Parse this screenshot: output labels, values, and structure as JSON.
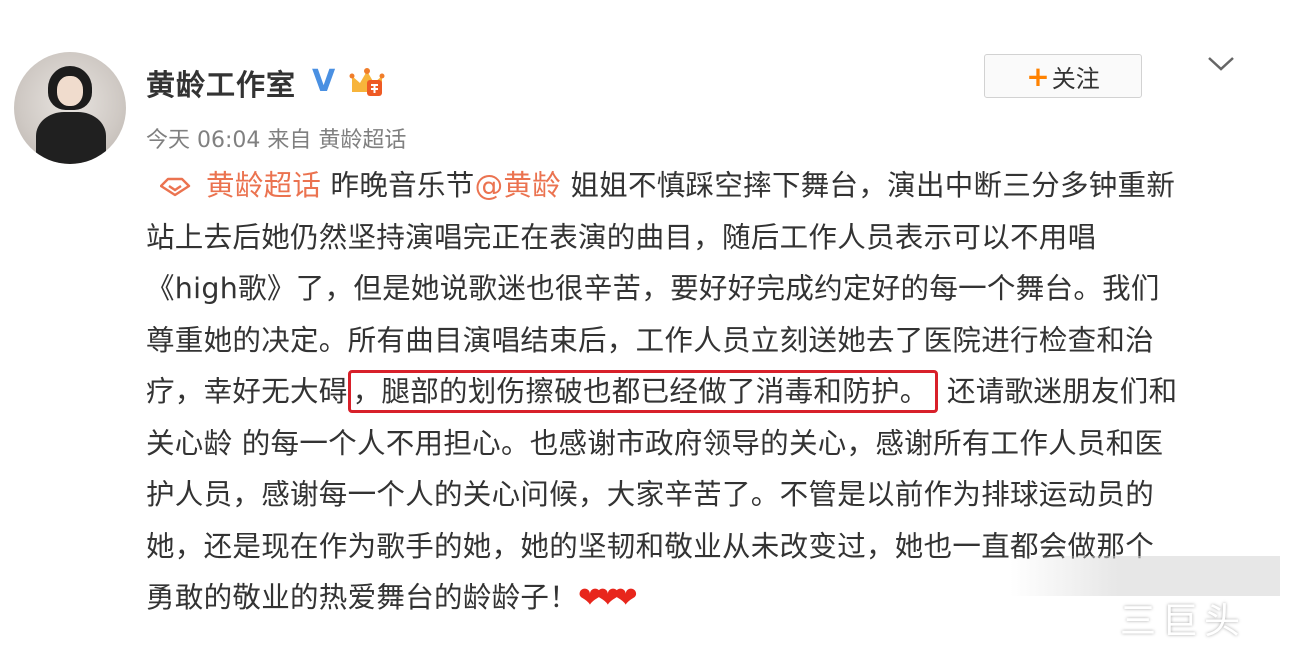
{
  "post": {
    "username": "黄龄工作室",
    "verified_mark": "V",
    "follow_label": "关注",
    "follow_plus": "+",
    "meta": "今天 06:04 来自 黄龄超话"
  },
  "content": {
    "line1_topic": "黄龄超话",
    "line1_a": " 昨晚音乐节",
    "line1_mention": "@黄龄",
    "line1_b": " 姐姐不慎踩空摔下舞台，演出中断三分多钟重新",
    "line2": "站上去后她仍然坚持演唱完正在表演的曲目，随后工作人员表示可以不用唱",
    "line3": "《high歌》了，但是她说歌迷也很辛苦，要好好完成约定好的每一个舞台。我们",
    "line4": "尊重她的决定。所有曲目演唱结束后，工作人员立刻送她去了医院进行检查和治",
    "line5_a": "疗，幸好无大碍",
    "line5_highlight": "，腿部的划伤擦破也都已经做了消毒和防护。",
    "line5_b": " 还请歌迷朋友们和",
    "line6": "关心龄 的每一个人不用担心。也感谢市政府领导的关心，感谢所有工作人员和医",
    "line7": "护人员，感谢每一个人的关心问候，大家辛苦了。不管是以前作为排球运动员的",
    "line8": "她，还是现在作为歌手的她，她的坚韧和敬业从未改变过，她也一直都会做那个",
    "line9": "勇敢的敬业的热爱舞台的龄龄子！",
    "hearts": "❤❤❤"
  },
  "watermark": "三巨头",
  "colors": {
    "link": "#eb7350",
    "highlight_border": "#d8202a",
    "follow_plus": "#ff8200",
    "verified": "#4a90e2"
  }
}
